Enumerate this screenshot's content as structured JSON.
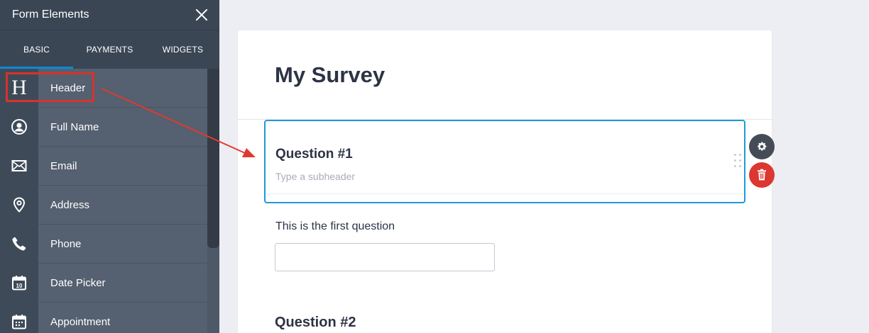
{
  "sidebar": {
    "title": "Form Elements",
    "tabs": [
      {
        "label": "BASIC",
        "active": true
      },
      {
        "label": "PAYMENTS",
        "active": false
      },
      {
        "label": "WIDGETS",
        "active": false
      }
    ],
    "items": [
      {
        "label": "Header",
        "icon": "header-icon"
      },
      {
        "label": "Full Name",
        "icon": "user-icon"
      },
      {
        "label": "Email",
        "icon": "envelope-icon"
      },
      {
        "label": "Address",
        "icon": "location-pin-icon"
      },
      {
        "label": "Phone",
        "icon": "phone-icon"
      },
      {
        "label": "Date Picker",
        "icon": "calendar-icon"
      },
      {
        "label": "Appointment",
        "icon": "appointment-calendar-icon"
      }
    ],
    "calendar_day": "10",
    "header_glyph": "H"
  },
  "form": {
    "title": "My Survey",
    "question1": {
      "title": "Question #1",
      "subheader_placeholder": "Type a subheader"
    },
    "field_label": "This is the first question",
    "field_value": "",
    "question2": {
      "title": "Question #2"
    }
  },
  "colors": {
    "accent": "#0a8ad6",
    "selection_border": "#1f9ad9",
    "annotation_red": "#d7332b",
    "delete_red": "#dc3730"
  }
}
